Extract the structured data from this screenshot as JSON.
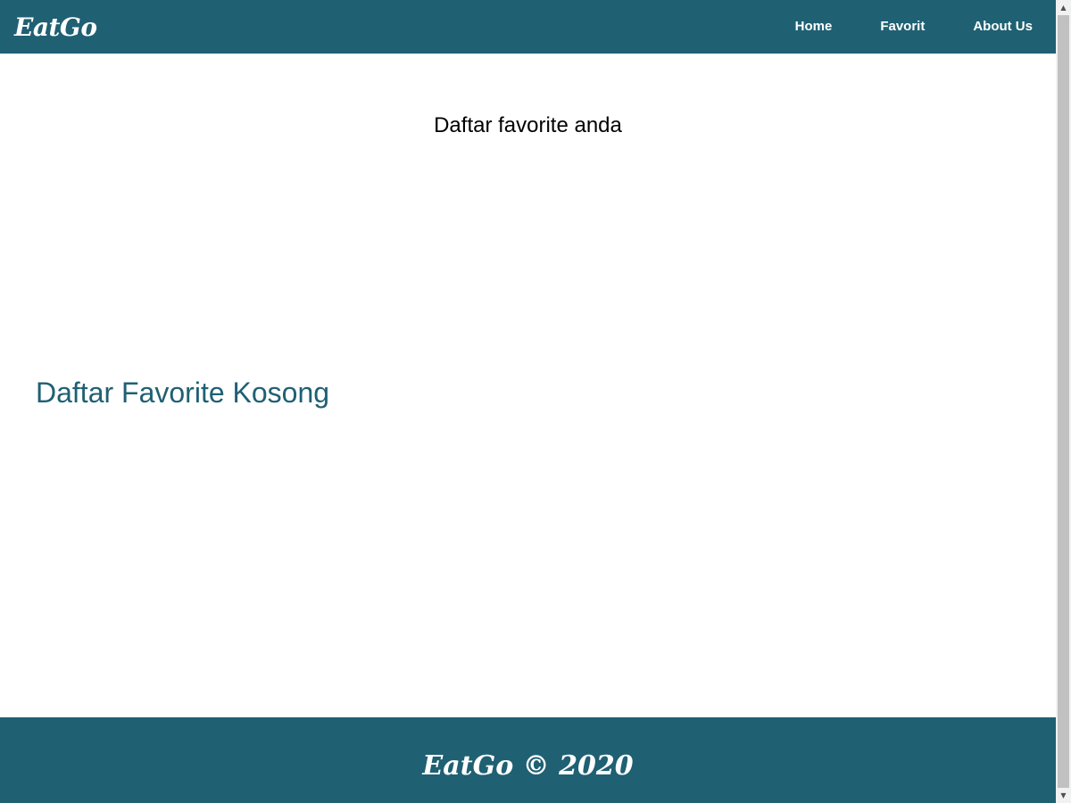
{
  "navbar": {
    "brand": "EatGo",
    "links": [
      {
        "label": "Home"
      },
      {
        "label": "Favorit"
      },
      {
        "label": "About Us"
      }
    ]
  },
  "main": {
    "heading": "Daftar favorite anda",
    "empty_message": "Daftar Favorite Kosong"
  },
  "footer": {
    "text": "EatGo © 2020"
  },
  "colors": {
    "primary": "#1f6073",
    "background": "#ffffff",
    "text": "#000000"
  },
  "icons": {
    "scroll_up": "scroll-up-arrow-icon",
    "scroll_down": "scroll-down-arrow-icon"
  }
}
